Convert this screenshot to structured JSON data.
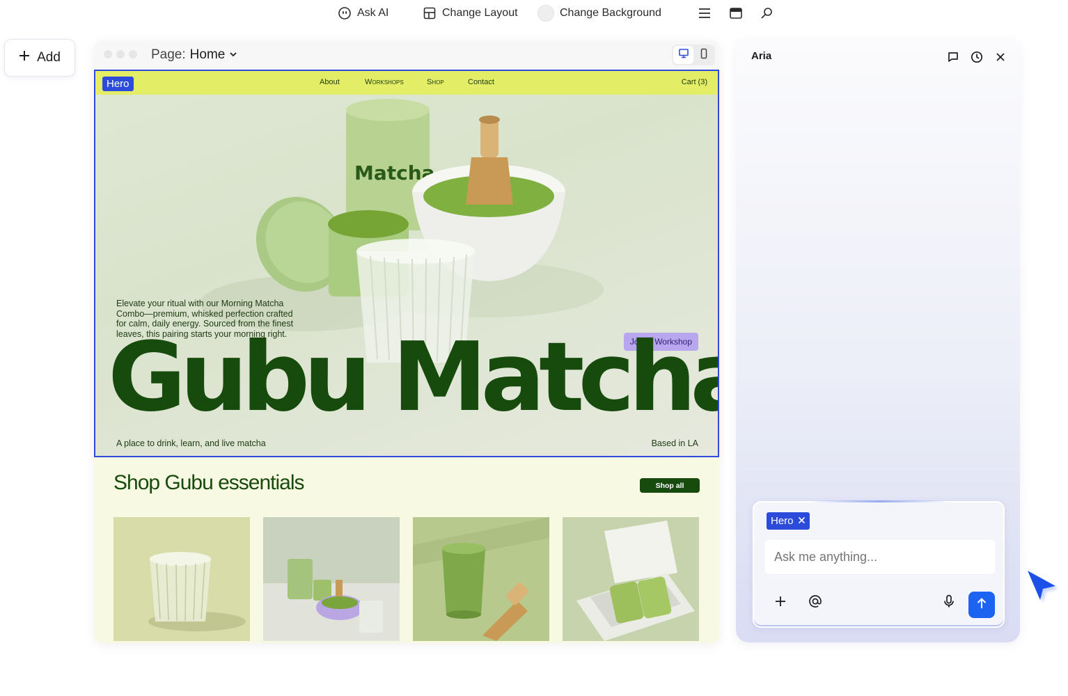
{
  "toolbar": {
    "ask_ai": "Ask AI",
    "change_layout": "Change Layout",
    "change_background": "Change Background",
    "icons": [
      "robot-icon",
      "layout-icon",
      "swatch-icon",
      "menu-icon",
      "window-icon",
      "pin-icon"
    ]
  },
  "add_button": {
    "label": "Add"
  },
  "editor": {
    "page_prefix": "Page:",
    "page_name": "Home",
    "devices": [
      "desktop-icon",
      "mobile-icon"
    ],
    "active_device": "desktop"
  },
  "site": {
    "selected_tag": "Hero",
    "nav": {
      "about": "About",
      "workshops": "Workshops",
      "shop": "Shop",
      "contact": "Contact",
      "cart": "Cart (3)"
    },
    "hero": {
      "description": "Elevate your ritual with our Morning Matcha Combo—premium, whisked perfection crafted for calm, daily energy. Sourced from the finest leaves, this pairing starts your morning right.",
      "cta": "Join a Workshop",
      "brand": "Gubu Matcha",
      "tagline": "A place to drink, learn, and live matcha",
      "location": "Based in LA",
      "tin_label": "Matcha"
    },
    "shop": {
      "title": "Shop Gubu essentials",
      "button": "Shop all",
      "products": [
        "glass-cup-image",
        "matcha-set-image",
        "matcha-latte-image",
        "gift-box-image"
      ]
    },
    "colors": {
      "brand_green": "#174b0d",
      "nav_yellow": "#e3ee66",
      "cta_purple": "#b8a7ef",
      "selection_blue": "#2d4bdb",
      "shop_bg": "#f8f9e2"
    }
  },
  "aria": {
    "title": "Aria",
    "icons": [
      "chat-icon",
      "history-icon",
      "close-icon"
    ],
    "context_chip": "Hero",
    "input_placeholder": "Ask me anything...",
    "send_color": "#1d63f2"
  }
}
